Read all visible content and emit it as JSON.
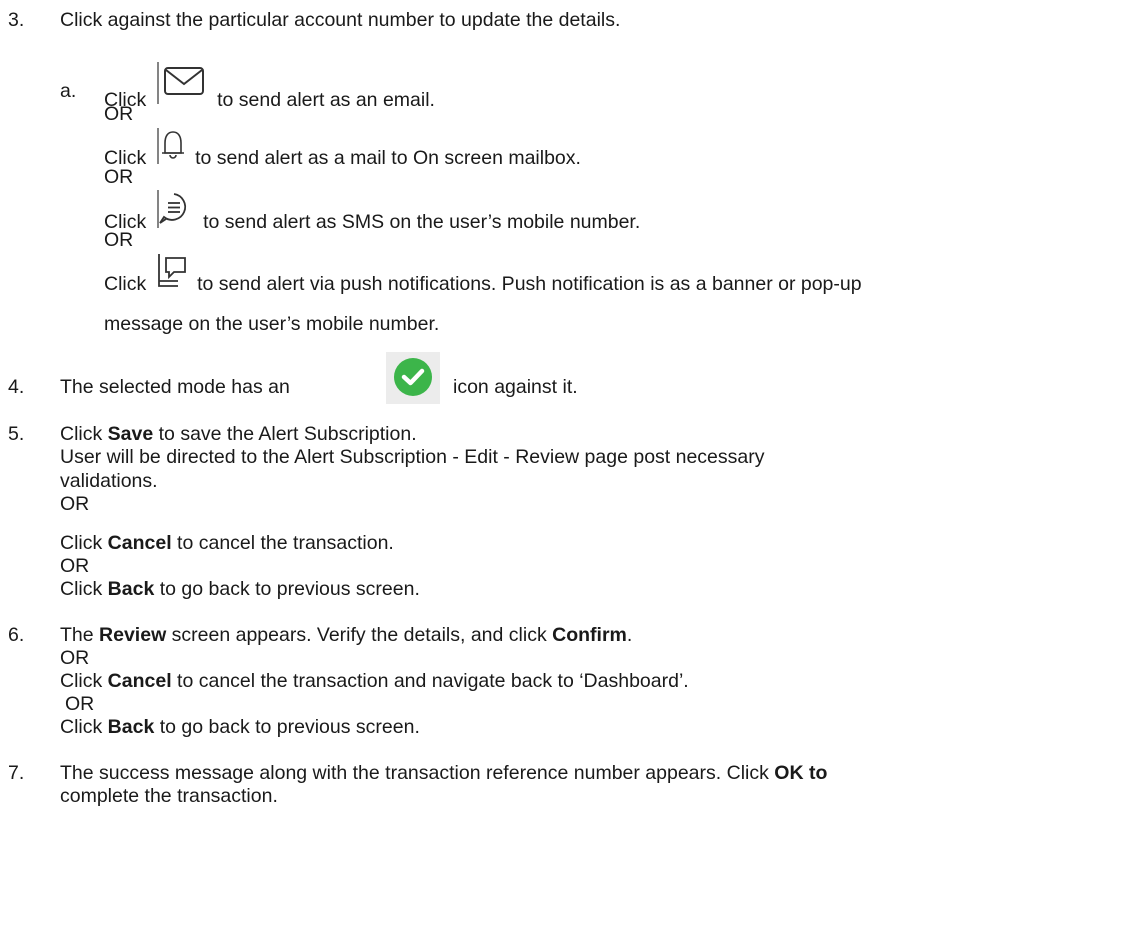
{
  "steps": {
    "s3": {
      "num": "3.",
      "text": "Click against the particular account number to update the details.",
      "sub_label": "a.",
      "click": "Click",
      "or": "OR",
      "email": "to send alert as an email.",
      "bell": "to send alert as a mail to On screen mailbox.",
      "sms": "to send alert as SMS on the user’s mobile number.",
      "push_line1": "to send alert via push notifications. Push notification is as a banner or pop-up",
      "push_line2": "message on the user’s mobile number."
    },
    "s4": {
      "num": "4.",
      "text_a": "The selected mode has an",
      "text_b": "icon against it."
    },
    "s5": {
      "num": "5.",
      "click": "Click",
      "save": "Save",
      "save_rest": "to save the Alert Subscription.",
      "line2": "User will be directed to the Alert Subscription - Edit - Review page post necessary",
      "line3": "validations.",
      "or": "OR",
      "cancel": "Cancel",
      "cancel_rest": "to cancel the transaction.",
      "back": "Back",
      "back_rest": "to go back to previous screen."
    },
    "s6": {
      "num": "6.",
      "the": "The",
      "review": "Review",
      "mid": "screen appears. Verify the details, and click",
      "confirm": "Confirm",
      "period": ".",
      "or": "OR",
      "click": "Click",
      "cancel": "Cancel",
      "cancel_rest": "to cancel the transaction and navigate back to ‘Dashboard’.",
      "back": "Back",
      "back_rest": "to go back to previous screen."
    },
    "s7": {
      "num": "7.",
      "text": "The success message along with the transaction reference number appears. Click",
      "ok": "OK to",
      "line2": "complete the transaction."
    }
  },
  "icons": [
    "email-icon",
    "bell-icon",
    "sms-icon",
    "push-notification-icon",
    "check-circle-icon"
  ],
  "colors": {
    "text": "#1a1a1a",
    "check_green": "#3cb54a",
    "icon_stroke": "#333333"
  }
}
